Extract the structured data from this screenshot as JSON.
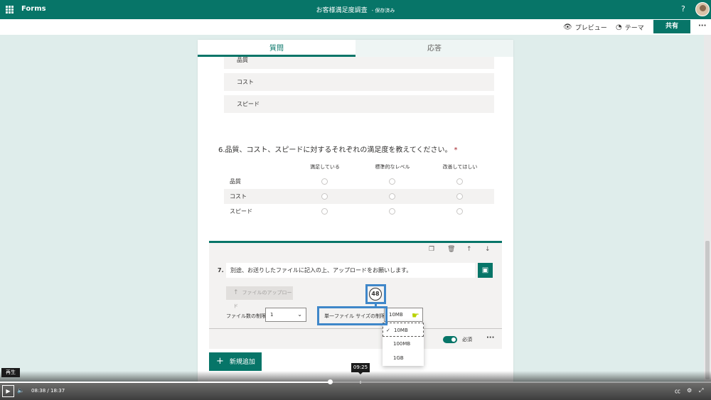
{
  "topbar": {
    "brand": "Forms",
    "title": "お客様満足度調査",
    "saved": "- 保存済み",
    "help": "?"
  },
  "toolbar": {
    "preview_label": "プレビュー",
    "theme_label": "テーマ",
    "share_label": "共有",
    "more": "···"
  },
  "tabs": {
    "questions": "質問",
    "responses": "応答"
  },
  "q5_options": [
    "品質",
    "コスト",
    "スピード"
  ],
  "q6": {
    "title": "6.品質、コスト、スピードに対するそれぞれの満足度を教えてください。",
    "required_mark": "*",
    "columns": [
      "満足している",
      "標準的なレベル",
      "改善してほしい"
    ],
    "rows": [
      "品質",
      "コスト",
      "スピード"
    ]
  },
  "q7": {
    "number": "7.",
    "text": "別途、お送りしたファイルに記入の上、アップロードをお願いします。",
    "upload_label": "ファイルのアップロード",
    "file_count_label": "ファイル数の制限:",
    "file_count_value": "1",
    "size_limit_label": "単一ファイル サイズの制限:",
    "size_limit_value": "10MB",
    "size_options": [
      "10MB",
      "100MB",
      "1GB"
    ],
    "selected_option": "10MB",
    "required_label": "必須",
    "more": "···"
  },
  "annotation": {
    "badge": "48",
    "color": "#3f87c9"
  },
  "add_new_label": "新規追加",
  "video": {
    "play_tooltip": "再生",
    "hover_time": "09:25",
    "current_time": "08:38",
    "separator": "/",
    "duration": "18:37",
    "progress_fraction": 0.464
  },
  "colors": {
    "accent": "#077568",
    "page_bg": "#dfedeb"
  }
}
